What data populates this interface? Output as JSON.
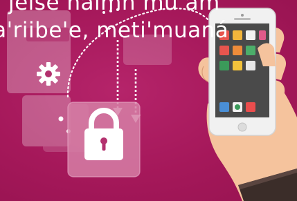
{
  "caption": {
    "line1": "na jeise naimn mu am",
    "line2": "ua'riibe'e, meti'muaná"
  },
  "colors": {
    "background": "#a8195c",
    "panel": "#c65a8a",
    "lock_tile": "#d780a8",
    "phone_body": "#f2f2f2",
    "hand_skin": "#f7c9a4",
    "sleeve": "#3d2f2b"
  },
  "icons": {
    "gear": "gear-icon",
    "lock": "padlock-icon",
    "phone": "smartphone-icon",
    "hand": "hand-icon"
  }
}
